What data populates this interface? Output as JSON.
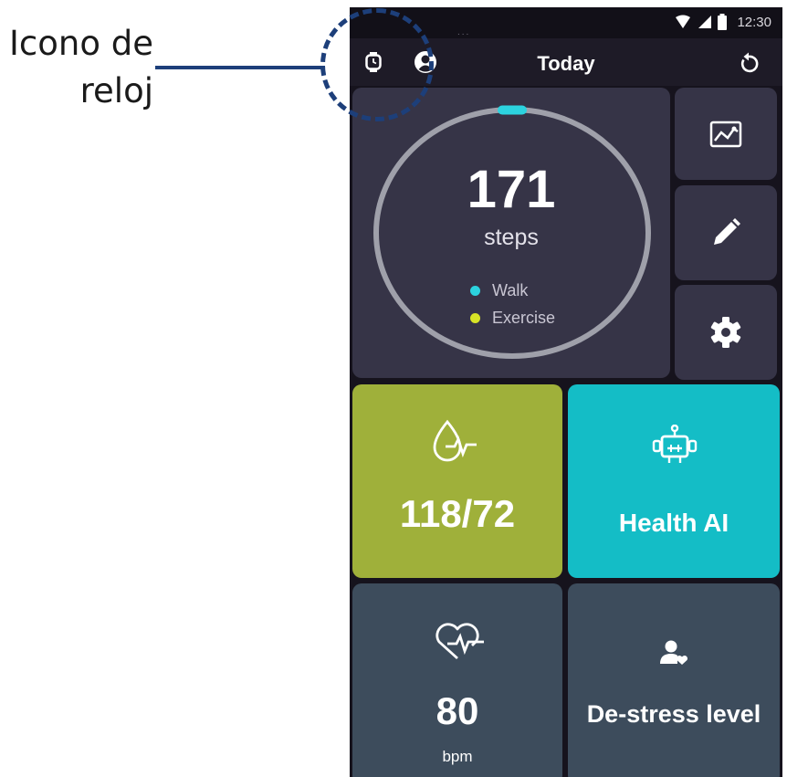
{
  "annotation": {
    "line1": "Icono de",
    "line2": "reloj"
  },
  "status_bar": {
    "time": "12:30",
    "dots": "...",
    "icons": [
      "wifi-icon",
      "signal-icon",
      "battery-icon"
    ]
  },
  "app_bar": {
    "title": "Today",
    "left_icons": [
      "watch-icon",
      "account-icon"
    ],
    "right_icon": "refresh-icon"
  },
  "steps": {
    "value": "171",
    "unit": "steps",
    "legend": [
      {
        "label": "Walk",
        "color": "#2cd3df"
      },
      {
        "label": "Exercise",
        "color": "#d7e326"
      }
    ]
  },
  "side_actions": [
    "chart-icon",
    "pencil-icon",
    "gear-icon"
  ],
  "blood_pressure": {
    "value": "118/72",
    "icon": "blood-drop-pulse-icon",
    "color": "#9fb03a"
  },
  "health_ai": {
    "label": "Health AI",
    "icon": "robot-icon",
    "color": "#14bdc6"
  },
  "heart_rate": {
    "value": "80",
    "unit": "bpm",
    "icon": "heart-pulse-icon"
  },
  "destress": {
    "label": "De-stress level",
    "icon": "person-heart-icon"
  },
  "colors": {
    "background": "#16131d",
    "card": "#363447",
    "bottom_card": "#3d4c5c",
    "annotation": "#1d3f7a"
  }
}
